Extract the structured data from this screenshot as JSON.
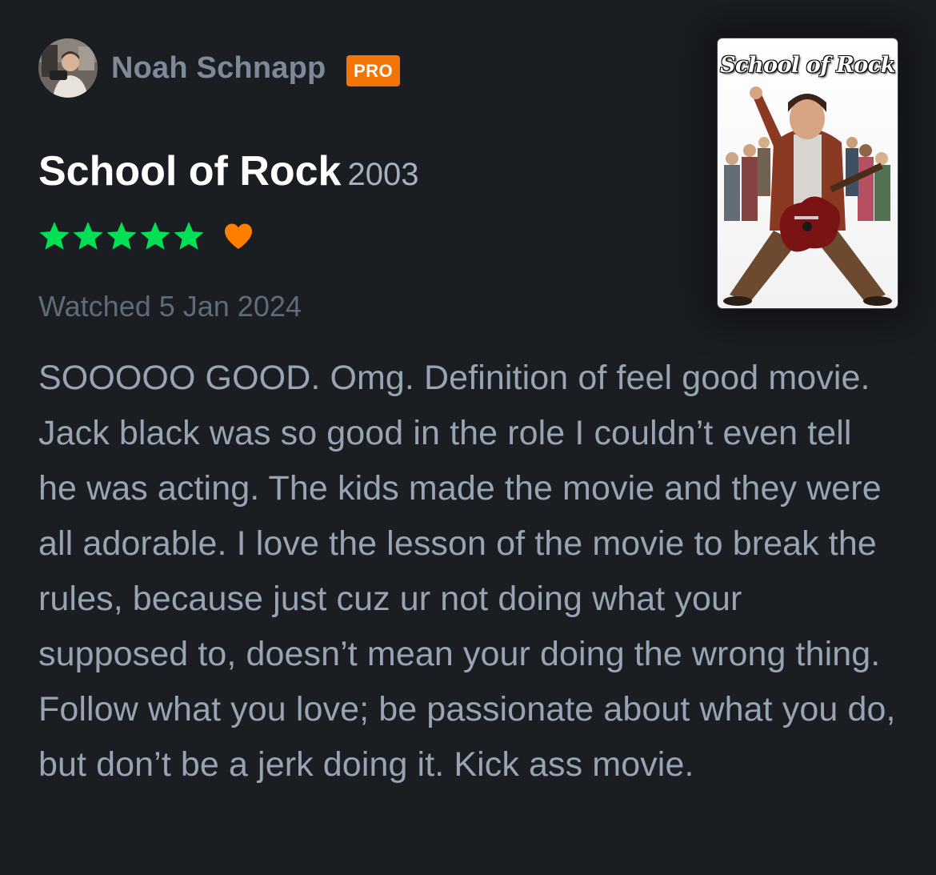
{
  "reviewer": {
    "name": "Noah Schnapp",
    "badge": "PRO",
    "avatar_icon": "user-avatar-photo"
  },
  "film": {
    "title": "School of Rock",
    "year": "2003",
    "poster_title": "School of Rock"
  },
  "rating": {
    "stars": 5,
    "max_stars": 5,
    "liked": true,
    "star_color": "#00e054",
    "heart_color": "#ff8000"
  },
  "watched": "Watched 5 Jan 2024",
  "review": {
    "text": "SOOOOO GOOD. Omg. Definition of feel good movie. Jack black was so good in the role I couldn’t even tell he was acting. The kids made the movie and they were all adorable. I love the lesson of the movie to break the rules, because just cuz ur not doing what your supposed to, doesn’t mean your doing the wrong thing. Follow what you love; be passionate about what you do, but don’t be a jerk doing it. Kick ass movie."
  },
  "colors": {
    "background": "#1a1d22",
    "username": "#7e8a9a",
    "badge": "#f27405",
    "title": "#ffffff",
    "year": "#a6b1bf",
    "watched": "#5f6b7a",
    "review_text": "#98a4b4"
  }
}
